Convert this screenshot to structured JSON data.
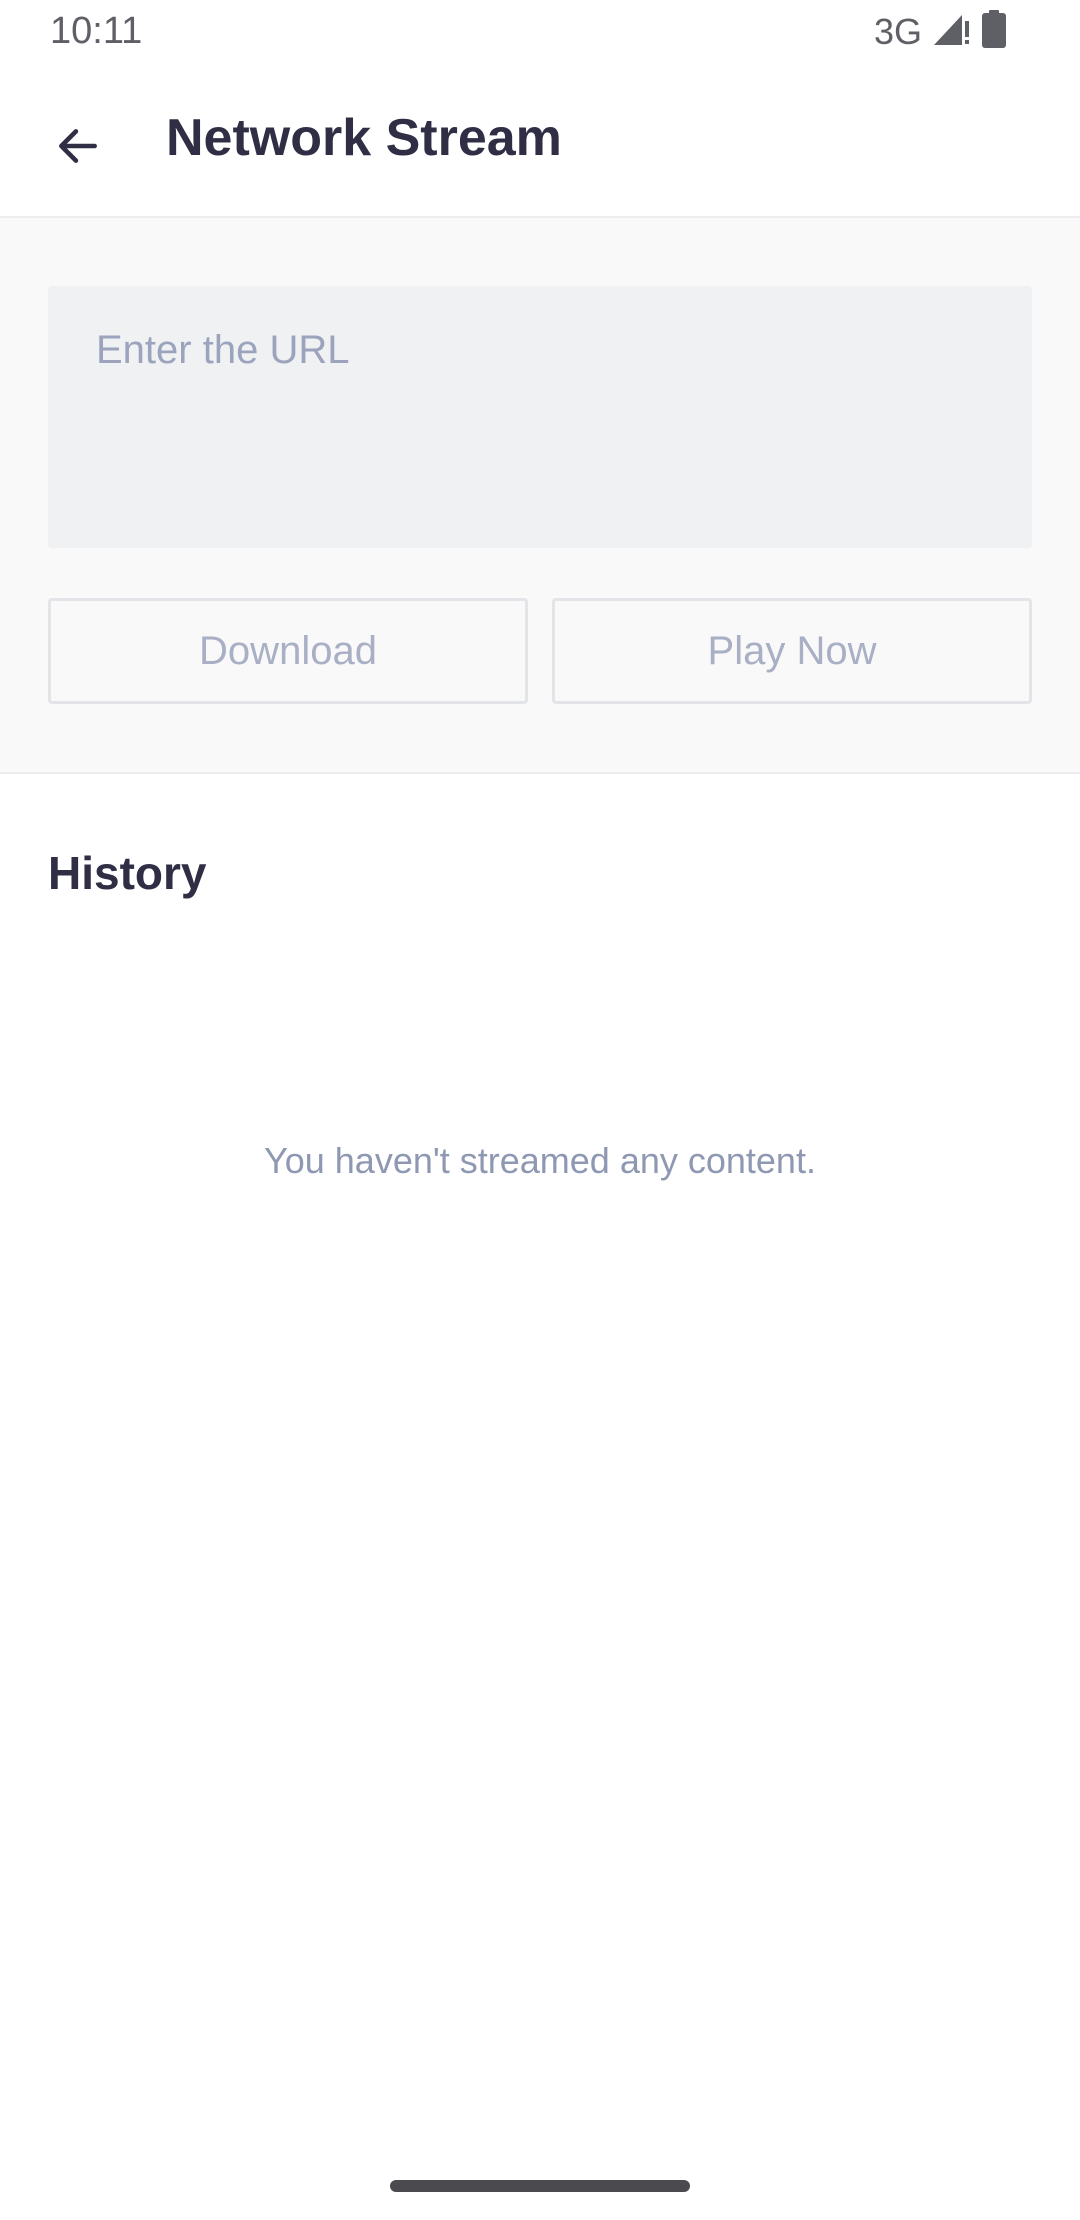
{
  "status_bar": {
    "time": "10:11",
    "network": "3G",
    "icons": [
      "signal-icon",
      "battery-icon"
    ]
  },
  "app_bar": {
    "back_icon": "arrow-left-icon",
    "title": "Network Stream"
  },
  "url_input": {
    "placeholder": "Enter the URL",
    "value": ""
  },
  "actions": {
    "download_label": "Download",
    "play_now_label": "Play Now"
  },
  "history": {
    "title": "History",
    "empty_message": "You haven't streamed any content."
  },
  "colors": {
    "title": "#2f2e45",
    "muted_text": "#9ba3bd",
    "input_bg": "#f0f1f3",
    "section_bg": "#f9f9f9"
  }
}
